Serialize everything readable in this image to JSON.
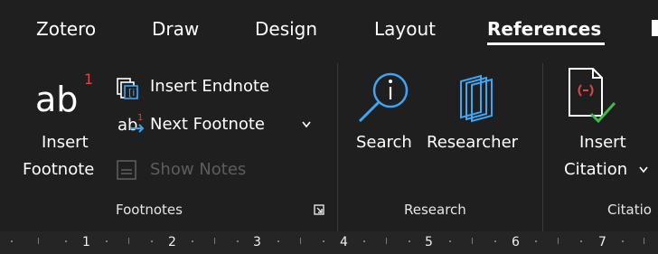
{
  "tabs": [
    "Zotero",
    "Draw",
    "Design",
    "Layout",
    "References"
  ],
  "active_tab": "References",
  "footnotes": {
    "insert_footnote_line1": "Insert",
    "insert_footnote_line2": "Footnote",
    "footnote_icon_text": "ab",
    "footnote_icon_sup": "1",
    "insert_endnote": "Insert Endnote",
    "next_footnote": "Next Footnote",
    "show_notes": "Show Notes",
    "group_label": "Footnotes"
  },
  "research": {
    "search": "Search",
    "researcher": "Researcher",
    "group_label": "Research"
  },
  "citations": {
    "insert_citation_line1": "Insert",
    "insert_citation_line2": "Citation",
    "group_label": "Citatio"
  },
  "ruler": {
    "numbers": [
      "1",
      "2",
      "3",
      "4",
      "5",
      "6",
      "7"
    ]
  },
  "colors": {
    "background": "#1f1f1f",
    "accent_blue": "#3da5f4",
    "icon_red": "#e0453f",
    "icon_green": "#3fb950",
    "disabled_text": "#5d5d5d"
  },
  "icons": [
    "footnote-icon",
    "endnote-icon",
    "next-footnote-icon",
    "show-notes-icon",
    "search-icon",
    "researcher-icon",
    "insert-citation-icon",
    "dialog-launcher-icon",
    "chevron-down-icon"
  ]
}
